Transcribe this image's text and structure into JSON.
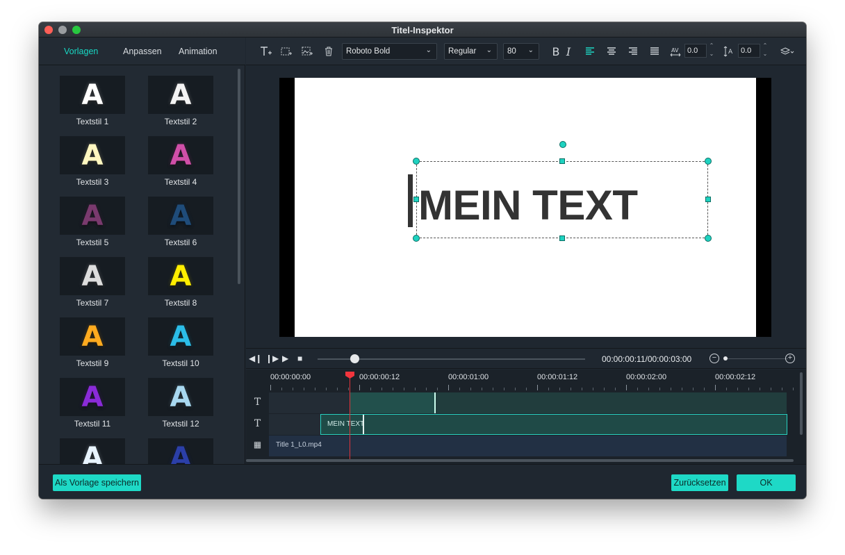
{
  "window": {
    "title": "Titel-Inspektor"
  },
  "left_tabs": [
    "Vorlagen",
    "Anpassen",
    "Animation"
  ],
  "styles": [
    {
      "label": "Textstil 1",
      "glyph": "A",
      "color": "#ffffff"
    },
    {
      "label": "Textstil 2",
      "glyph": "A",
      "color": "#f4f4f4"
    },
    {
      "label": "Textstil 3",
      "glyph": "A",
      "color": "#fff7c0"
    },
    {
      "label": "Textstil 4",
      "glyph": "A",
      "color": "#d04fa8"
    },
    {
      "label": "Textstil 5",
      "glyph": "A",
      "color": "#7a3a6e"
    },
    {
      "label": "Textstil 6",
      "glyph": "A",
      "color": "#1f4c7a"
    },
    {
      "label": "Textstil 7",
      "glyph": "A",
      "color": "#dddddd"
    },
    {
      "label": "Textstil 8",
      "glyph": "A",
      "color": "#ffee00"
    },
    {
      "label": "Textstil 9",
      "glyph": "A",
      "color": "#ffab1f"
    },
    {
      "label": "Textstil 10",
      "glyph": "A",
      "color": "#2bbde8"
    },
    {
      "label": "Textstil 11",
      "glyph": "A",
      "color": "#8a2bd8"
    },
    {
      "label": "Textstil 12",
      "glyph": "A",
      "color": "#a8d8f0"
    },
    {
      "label": "",
      "glyph": "A",
      "color": "#e8f4ff"
    },
    {
      "label": "",
      "glyph": "A",
      "color": "#2b3fa8"
    }
  ],
  "toolbar": {
    "font_family": "Roboto Bold",
    "font_weight": "Regular",
    "font_size": "80",
    "bold": "B",
    "italic": "I",
    "char_spacing": "0.0",
    "line_spacing": "0.0"
  },
  "preview": {
    "text": "MEIN TEXT"
  },
  "playback": {
    "time": "00:00:00:11/00:00:03:00",
    "progress": 0.2,
    "zoom": 0.0
  },
  "timeline": {
    "ticks": [
      "00:00:00:00",
      "00:00:00:12",
      "00:00:01:00",
      "00:00:01:12",
      "00:00:02:00",
      "00:00:02:12"
    ],
    "clip_title": "MEIN TEXT",
    "clip_video": "Title 1_L0.mp4"
  },
  "footer": {
    "save_template": "Als Vorlage speichern",
    "reset": "Zurücksetzen",
    "ok": "OK"
  },
  "colors": {
    "accent": "#1ed9c6",
    "playhead": "#f2353d",
    "background": "#1f2730"
  }
}
